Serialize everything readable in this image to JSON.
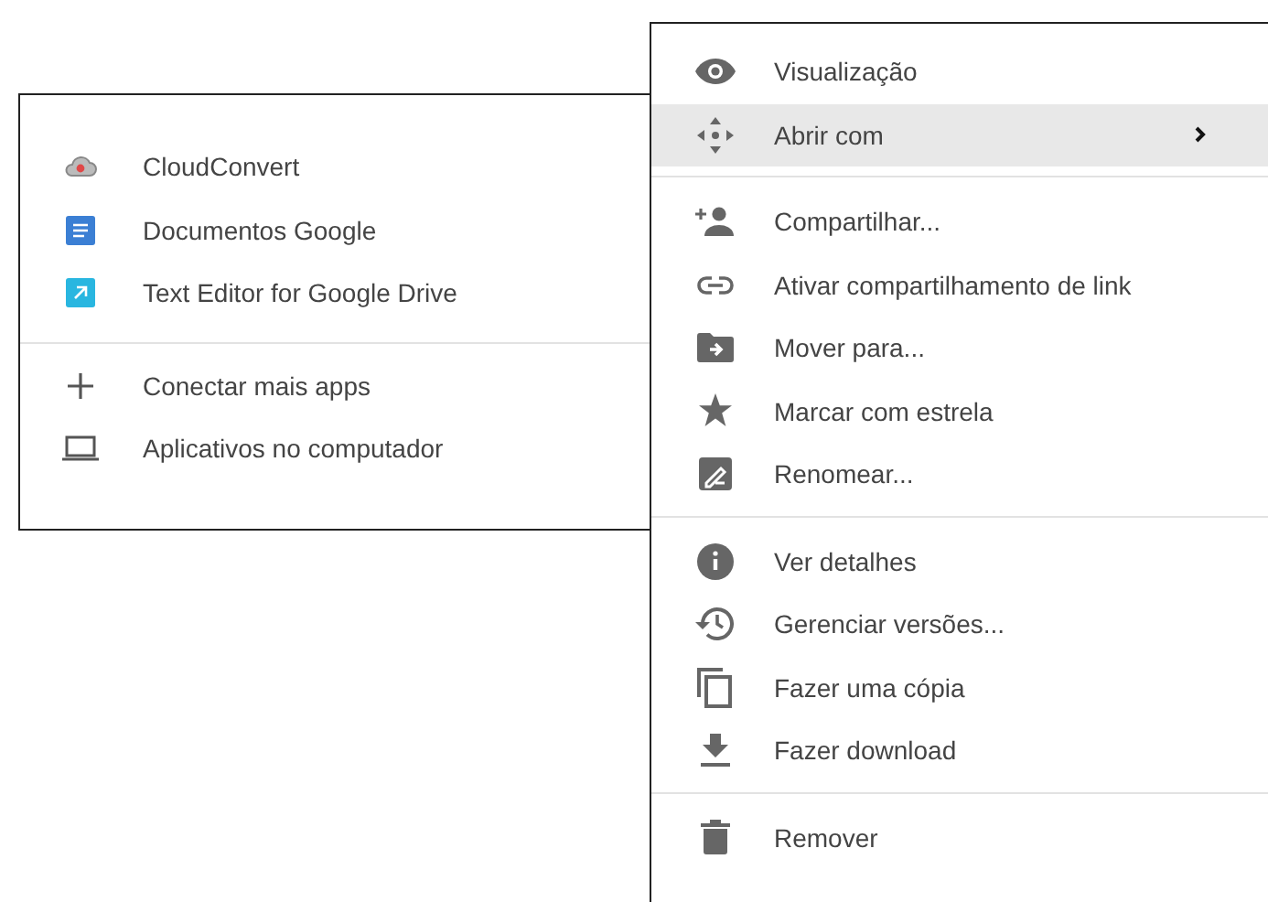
{
  "apps_menu": {
    "sections": [
      [
        {
          "label": "CloudConvert",
          "kind": "cloud"
        },
        {
          "label": "Documentos Google",
          "kind": "docs"
        },
        {
          "label": "Text Editor for Google Drive",
          "kind": "editor"
        }
      ],
      [
        {
          "label": "Conectar mais apps",
          "kind": "plus"
        },
        {
          "label": "Aplicativos no computador",
          "kind": "laptop"
        }
      ]
    ]
  },
  "context_menu": {
    "sections": [
      [
        {
          "label": "Visualização",
          "kind": "eye",
          "selected": false,
          "submenu": false
        },
        {
          "label": "Abrir com",
          "kind": "move",
          "selected": true,
          "submenu": true
        }
      ],
      [
        {
          "label": "Compartilhar...",
          "kind": "share",
          "selected": false,
          "submenu": false
        },
        {
          "label": "Ativar compartilhamento de link",
          "kind": "link",
          "selected": false,
          "submenu": false
        },
        {
          "label": "Mover para...",
          "kind": "folder",
          "selected": false,
          "submenu": false
        },
        {
          "label": "Marcar com estrela",
          "kind": "star",
          "selected": false,
          "submenu": false
        },
        {
          "label": "Renomear...",
          "kind": "rename",
          "selected": false,
          "submenu": false
        }
      ],
      [
        {
          "label": "Ver detalhes",
          "kind": "info",
          "selected": false,
          "submenu": false
        },
        {
          "label": "Gerenciar versões...",
          "kind": "history",
          "selected": false,
          "submenu": false
        },
        {
          "label": "Fazer uma cópia",
          "kind": "copy",
          "selected": false,
          "submenu": false
        },
        {
          "label": "Fazer download",
          "kind": "download",
          "selected": false,
          "submenu": false
        }
      ],
      [
        {
          "label": "Remover",
          "kind": "trash",
          "selected": false,
          "submenu": false
        }
      ]
    ]
  }
}
